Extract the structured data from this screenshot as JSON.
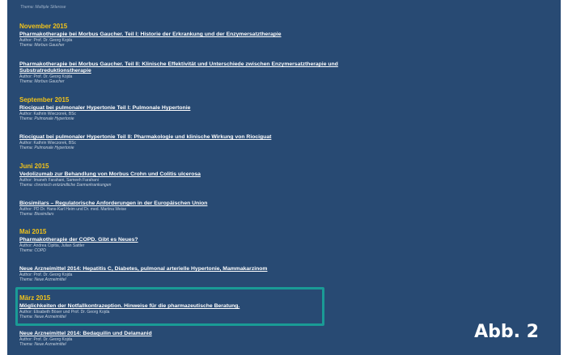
{
  "top_fragment": "Thema: Multiple Sklerose",
  "sections": [
    {
      "month": "November 2015",
      "articles": [
        {
          "title": "Pharmakotherapie bei Morbus Gaucher. Teil I: Historie der Erkrankung und der Enzymersatztherapie",
          "author": "Author: Prof. Dr. Georg Kojda",
          "theme": "Thema: Morbus Gaucher"
        },
        {
          "title_line1": "Pharmakotherapie bei Morbus Gaucher. Teil II: Klinische Effektivität und Unterschiede zwischen Enzymersatztherapie und",
          "title_line2": "Substratreduktionstherapie",
          "author": "Author: Prof. Dr. Georg Kojda",
          "theme": "Thema: Morbus Gaucher"
        }
      ]
    },
    {
      "month": "September 2015",
      "articles": [
        {
          "title": "Riociguat bei pulmonaler Hypertonie Teil I: Pulmonale Hypertonie",
          "author": "Author: Kathrin Wieczorek, BSc",
          "theme": "Thema: Pulmonale Hypertonie"
        },
        {
          "title": "Riociguat bei pulmonaler Hypertonie Teil II: Pharmakologie und klinische Wirkung von Riociguat",
          "author": "Author: Kathrin Wieczorek, BSc",
          "theme": "Thema: Pulmonale Hypertonie"
        }
      ]
    },
    {
      "month": "Juni 2015",
      "articles": [
        {
          "title": "Vedolizumab zur Behandlung von Morbus Crohn und Colitis ulcerosa",
          "author": "Author: Imaneh Farahani, Sameeh Farahani",
          "theme": "Thema: chronisch entzündliche Darmerkrankungen"
        },
        {
          "title": "Biosimilars – Regulatorische Anforderungen in der Europäischen Union",
          "author": "Author: PD Dr. Hans-Karl Heim und Dr. med. Martina Weise",
          "theme": "Thema: Biosimilars"
        }
      ]
    },
    {
      "month": "Mai 2015",
      "articles": [
        {
          "title": "Pharmakotherapie der COPD. Gibt es Neues?",
          "author": "Author: Andrea Cipitia, Julian Sattler",
          "theme": "Thema: COPD"
        },
        {
          "title": "Neue Arzneimittel 2014: Hepatitis C, Diabetes, pulmonal arterielle Hypertonie, Mammakarzinom",
          "author": "Author: Prof. Dr. Georg Kojda",
          "theme": "Thema: Neue Arzneimittel"
        }
      ]
    },
    {
      "month": "März 2015",
      "articles": [
        {
          "title": "Möglichkeiten der Notfallkontrazeption. Hinweise für die pharmazeutische Beratung.",
          "author": "Author: Elisabeth Böser und Prof. Dr. Georg Kojda",
          "theme": "Thema: Neue Arzneimittel"
        },
        {
          "title": "Neue Arzneimittel 2014: Bedaquilin und Delamanid",
          "author": "Author: Prof. Dr. Georg Kojda",
          "theme": "Thema: Neue Arzneimittel"
        }
      ]
    }
  ],
  "figure_label": "Abb. 2",
  "colors": {
    "background": "#284a73",
    "month_heading": "#f2c31a",
    "link": "#ffffff",
    "highlight_border": "#1a9b96"
  }
}
